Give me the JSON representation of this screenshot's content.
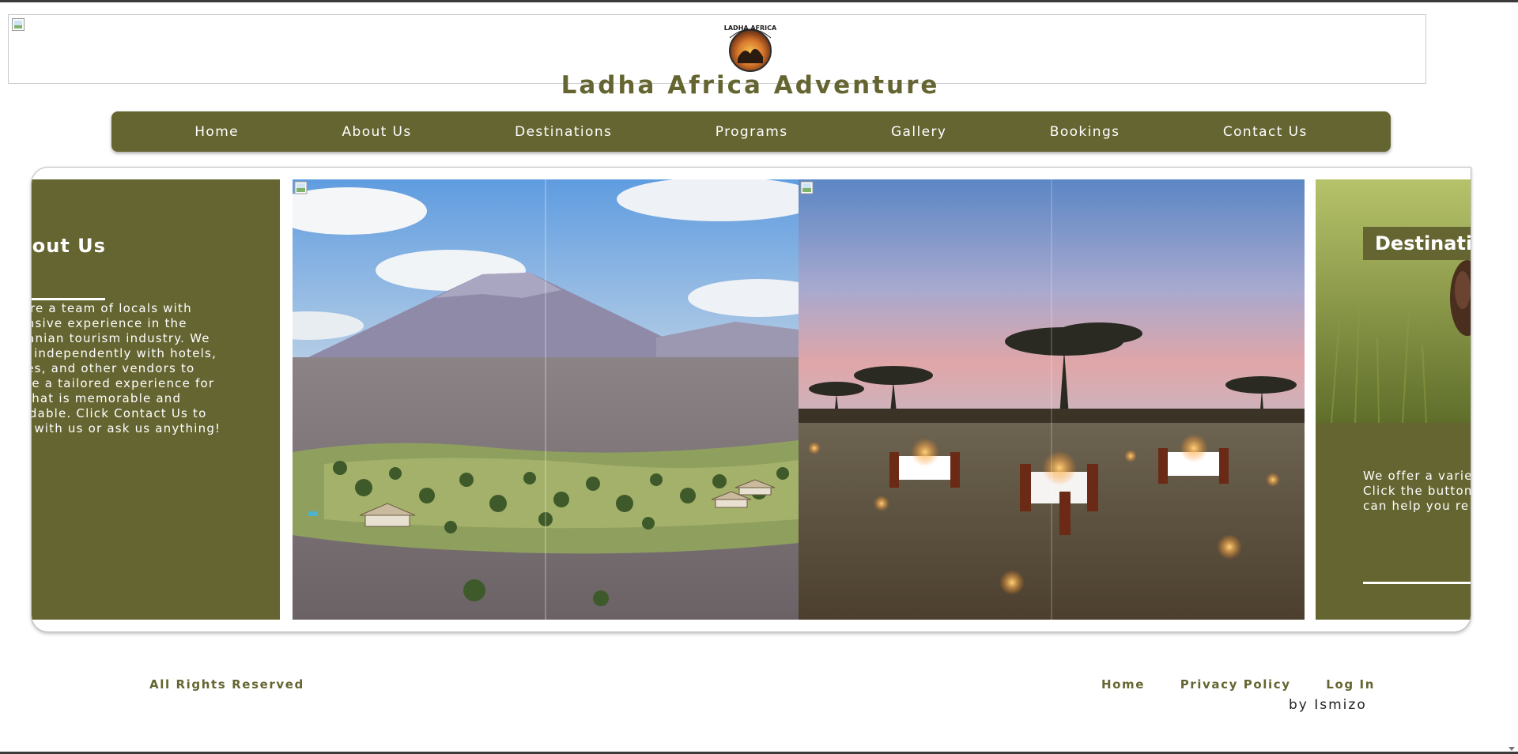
{
  "header": {
    "title": "Ladha Africa Adventure",
    "logo_text": "LADHA AFRICA"
  },
  "nav": {
    "items": [
      "Home",
      "About Us",
      "Destinations",
      "Programs",
      "Gallery",
      "Bookings",
      "Contact Us"
    ]
  },
  "carousel": {
    "about": {
      "heading": "About Us",
      "text": "We are a team of locals with extensive experience in the Tanzanian tourism industry. We work independently with hotels, lodges, and other vendors to create a tailored experience for you that is memorable and affordable. Click Contact Us to book with us or ask us anything!"
    },
    "destinations": {
      "heading": "Destinations",
      "text_lines": [
        "We offer a variety",
        "Click the button",
        "can help you re"
      ]
    }
  },
  "footer": {
    "rights": "All Rights Reserved",
    "links": [
      "Home",
      "Privacy Policy",
      "Log In"
    ],
    "credit": "by Ismizo"
  },
  "colors": {
    "brand_olive": "#656532",
    "text_white": "#ffffff"
  }
}
